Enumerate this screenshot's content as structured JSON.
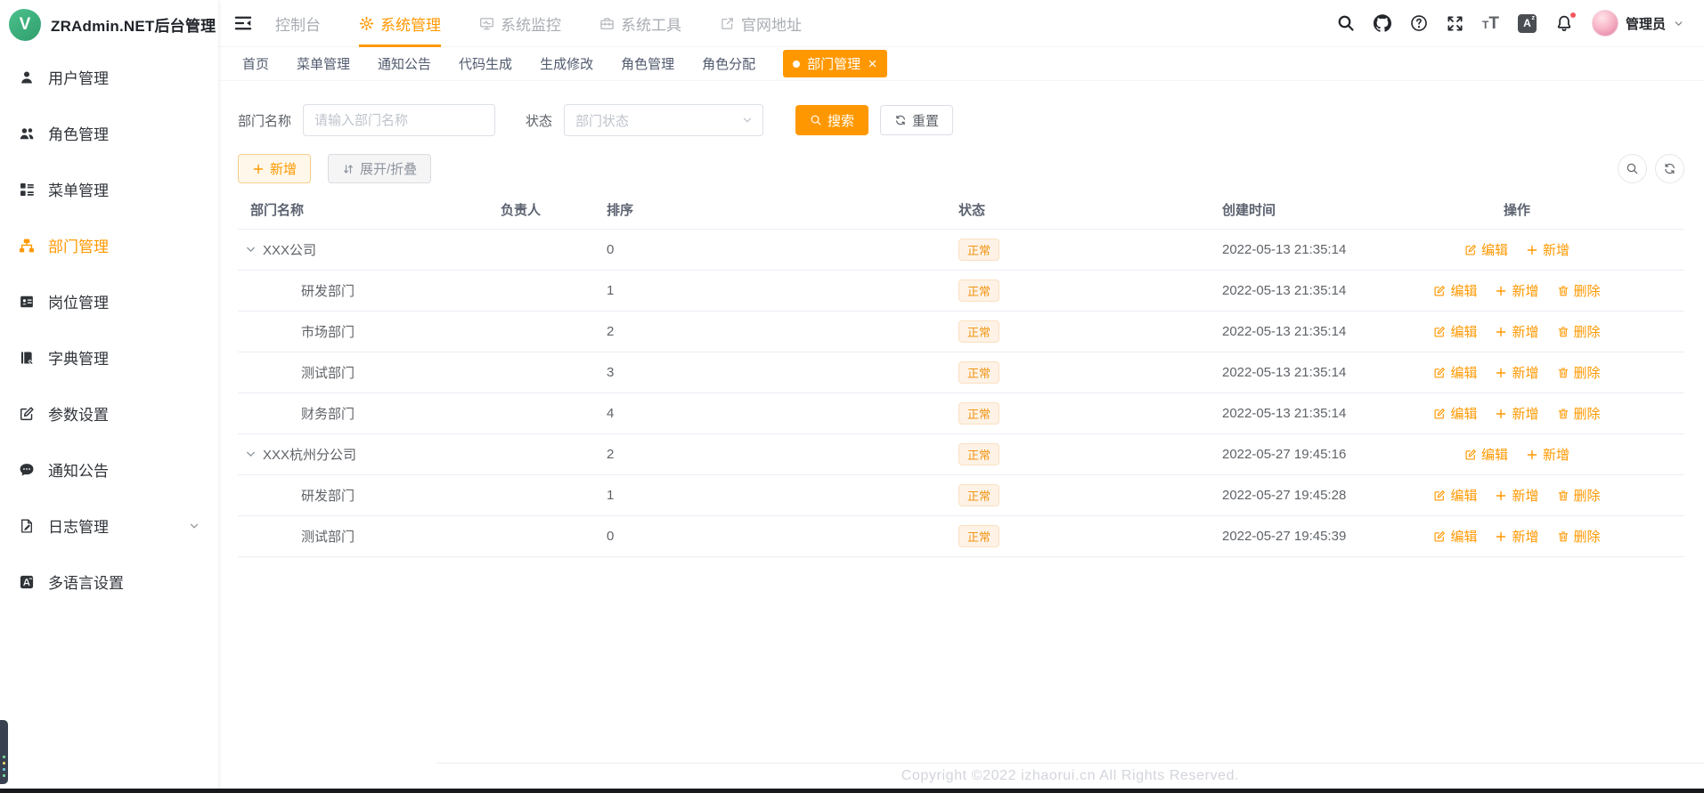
{
  "app": {
    "title": "ZRAdmin.NET后台管理",
    "logo_letter": "V"
  },
  "topnav": {
    "items": [
      {
        "label": "控制台",
        "icon": null,
        "active": false
      },
      {
        "label": "系统管理",
        "icon": "gear",
        "active": true
      },
      {
        "label": "系统监控",
        "icon": "monitor",
        "active": false
      },
      {
        "label": "系统工具",
        "icon": "toolbox",
        "active": false
      },
      {
        "label": "官网地址",
        "icon": "external-link",
        "active": false
      }
    ],
    "right_icons": [
      "search",
      "github",
      "question",
      "fullscreen",
      "font-size",
      "translate",
      "bell"
    ],
    "bell_has_dot": true,
    "user": {
      "name": "管理员"
    }
  },
  "sidebar": {
    "items": [
      {
        "label": "用户管理",
        "icon": "user",
        "active": false
      },
      {
        "label": "角色管理",
        "icon": "users",
        "active": false
      },
      {
        "label": "菜单管理",
        "icon": "menu-tree",
        "active": false
      },
      {
        "label": "部门管理",
        "icon": "sitemap",
        "active": true
      },
      {
        "label": "岗位管理",
        "icon": "id-badge",
        "active": false
      },
      {
        "label": "字典管理",
        "icon": "dictionary",
        "active": false
      },
      {
        "label": "参数设置",
        "icon": "edit-square",
        "active": false
      },
      {
        "label": "通知公告",
        "icon": "message",
        "active": false
      },
      {
        "label": "日志管理",
        "icon": "log",
        "active": false,
        "has_children": true
      },
      {
        "label": "多语言设置",
        "icon": "language",
        "active": false
      }
    ]
  },
  "tabs": {
    "items": [
      {
        "label": "首页",
        "active": false
      },
      {
        "label": "菜单管理",
        "active": false
      },
      {
        "label": "通知公告",
        "active": false
      },
      {
        "label": "代码生成",
        "active": false
      },
      {
        "label": "生成修改",
        "active": false
      },
      {
        "label": "角色管理",
        "active": false
      },
      {
        "label": "角色分配",
        "active": false
      },
      {
        "label": "部门管理",
        "active": true,
        "closable": true
      }
    ]
  },
  "filter": {
    "name_label": "部门名称",
    "name_placeholder": "请输入部门名称",
    "name_value": "",
    "status_label": "状态",
    "status_placeholder": "部门状态",
    "search_label": "搜索",
    "reset_label": "重置"
  },
  "toolbar": {
    "add_label": "新增",
    "toggle_label": "展开/折叠"
  },
  "table": {
    "columns": [
      "部门名称",
      "负责人",
      "排序",
      "状态",
      "创建时间",
      "操作"
    ],
    "action_labels": {
      "edit": "编辑",
      "add": "新增",
      "delete": "删除"
    },
    "rows": [
      {
        "name": "XXX公司",
        "parent": true,
        "expanded": true,
        "leader": "",
        "sort": "0",
        "status": "正常",
        "created_at": "2022-05-13 21:35:14",
        "actions": [
          "edit",
          "add"
        ]
      },
      {
        "name": "研发部门",
        "parent": false,
        "leader": "",
        "sort": "1",
        "status": "正常",
        "created_at": "2022-05-13 21:35:14",
        "actions": [
          "edit",
          "add",
          "delete"
        ]
      },
      {
        "name": "市场部门",
        "parent": false,
        "leader": "",
        "sort": "2",
        "status": "正常",
        "created_at": "2022-05-13 21:35:14",
        "actions": [
          "edit",
          "add",
          "delete"
        ]
      },
      {
        "name": "测试部门",
        "parent": false,
        "leader": "",
        "sort": "3",
        "status": "正常",
        "created_at": "2022-05-13 21:35:14",
        "actions": [
          "edit",
          "add",
          "delete"
        ]
      },
      {
        "name": "财务部门",
        "parent": false,
        "leader": "",
        "sort": "4",
        "status": "正常",
        "created_at": "2022-05-13 21:35:14",
        "actions": [
          "edit",
          "add",
          "delete"
        ]
      },
      {
        "name": "XXX杭州分公司",
        "parent": true,
        "expanded": true,
        "leader": "",
        "sort": "2",
        "status": "正常",
        "created_at": "2022-05-27 19:45:16",
        "actions": [
          "edit",
          "add"
        ]
      },
      {
        "name": "研发部门",
        "parent": false,
        "leader": "",
        "sort": "1",
        "status": "正常",
        "created_at": "2022-05-27 19:45:28",
        "actions": [
          "edit",
          "add",
          "delete"
        ]
      },
      {
        "name": "测试部门",
        "parent": false,
        "leader": "",
        "sort": "0",
        "status": "正常",
        "created_at": "2022-05-27 19:45:39",
        "actions": [
          "edit",
          "add",
          "delete"
        ]
      }
    ]
  },
  "footer": {
    "copyright": "Copyright ©2022 izhaorui.cn All Rights Reserved."
  },
  "colors": {
    "primary": "#ff9800",
    "badge_bg": "#fdf2e5",
    "badge_border": "#fbe0c0",
    "badge_text": "#f29412",
    "logo_green": "#41b883",
    "notify_dot": "#f3575c"
  }
}
